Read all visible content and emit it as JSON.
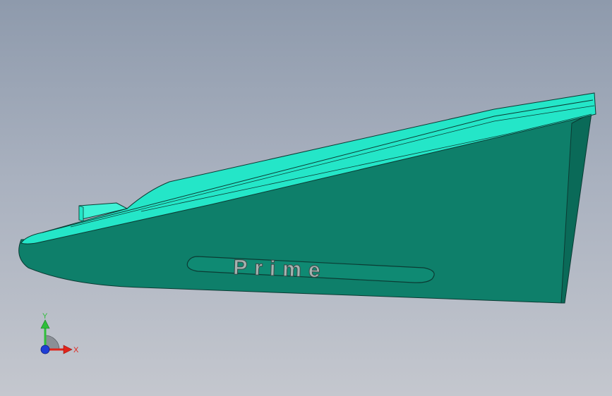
{
  "model": {
    "embossed_text": "Prime",
    "colors": {
      "body": "#0e7f6a",
      "body_dark": "#0a6a58",
      "top_face": "#24e6c8",
      "top_face_light": "#3ff2d6",
      "edge": "#0b3b33",
      "text_fill": "#a6b2b0"
    }
  },
  "triad": {
    "x_label": "X",
    "y_label": "Y",
    "colors": {
      "x": "#e0241b",
      "y": "#2fbf3a",
      "z": "#1f3ed6"
    }
  }
}
